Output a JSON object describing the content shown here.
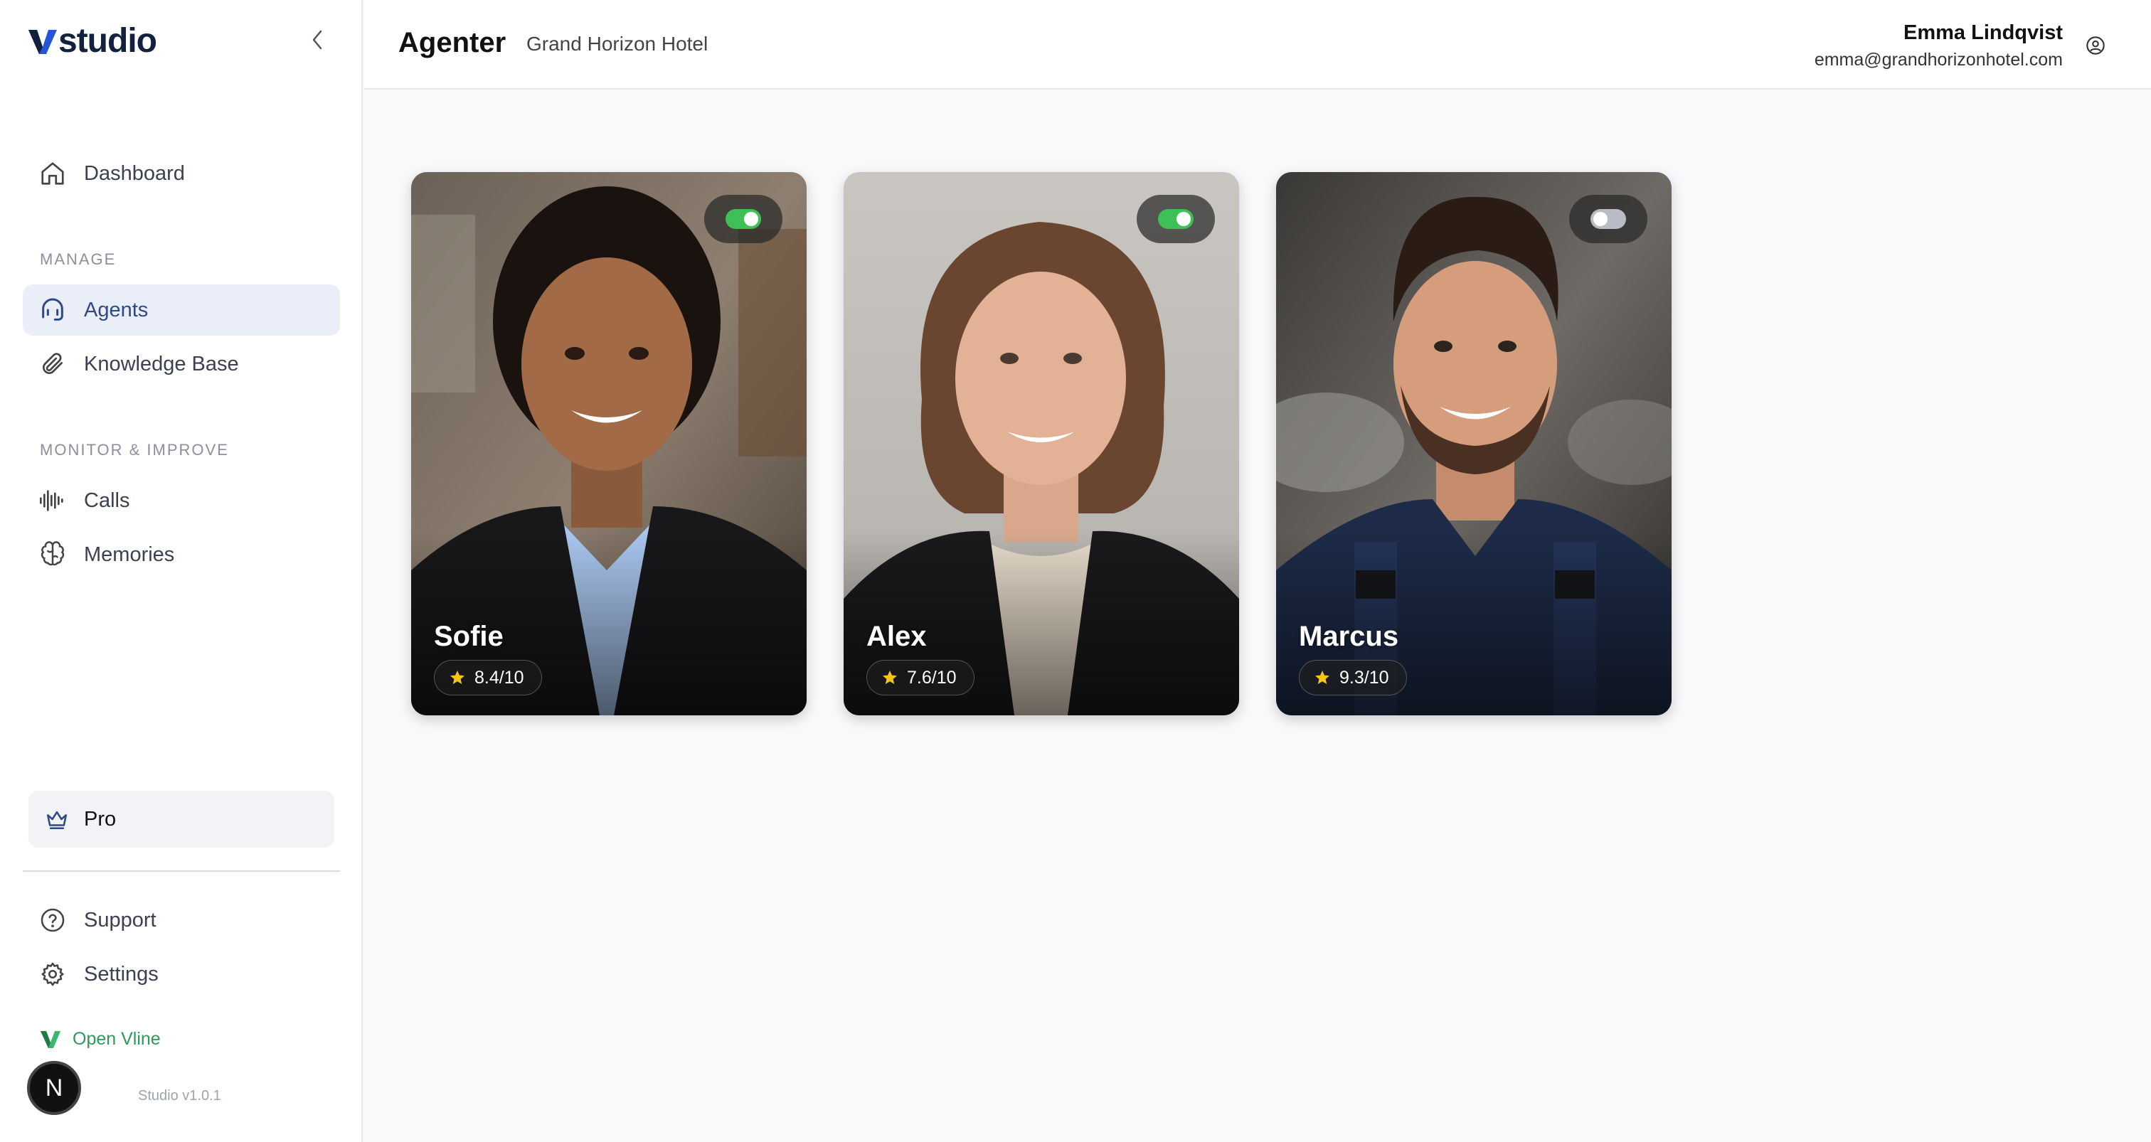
{
  "app": {
    "logo_text": "studio",
    "version": "Studio v1.0.1",
    "open_vline": "Open Vline"
  },
  "sidebar": {
    "dashboard": "Dashboard",
    "manage_label": "MANAGE",
    "agents": "Agents",
    "knowledge_base": "Knowledge Base",
    "monitor_label": "MONITOR & IMPROVE",
    "calls": "Calls",
    "memories": "Memories",
    "pro": "Pro",
    "support": "Support",
    "settings": "Settings"
  },
  "avatar_letter": "N",
  "header": {
    "title": "Agenter",
    "subtitle": "Grand Horizon Hotel",
    "user_name": "Emma Lindqvist",
    "user_email": "emma@grandhorizonhotel.com"
  },
  "agents": [
    {
      "name": "Sofie",
      "rating": "8.4/10",
      "enabled": true
    },
    {
      "name": "Alex",
      "rating": "7.6/10",
      "enabled": true
    },
    {
      "name": "Marcus",
      "rating": "9.3/10",
      "enabled": false
    }
  ],
  "colors": {
    "accent": "#2f4a86",
    "active_bg": "#e9eef8",
    "toggle_on": "#3fbf57",
    "toggle_off": "#b9bcc4",
    "vline_green": "#2b9a5b",
    "star": "#f5c518"
  },
  "icons": {
    "dashboard": "home-icon",
    "agents": "headset-icon",
    "knowledge_base": "paperclip-icon",
    "calls": "waveform-icon",
    "memories": "brain-icon",
    "pro": "crown-icon",
    "support": "help-circle-icon",
    "settings": "gear-icon",
    "user": "user-circle-icon",
    "collapse": "chevron-left-icon"
  }
}
